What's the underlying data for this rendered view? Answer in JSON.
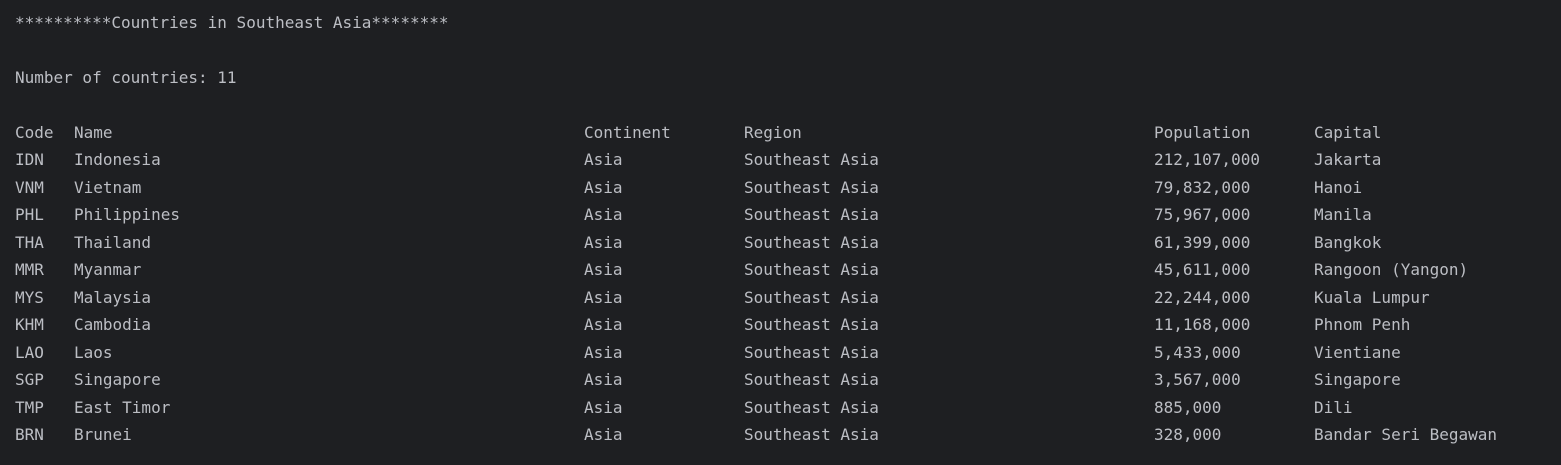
{
  "banner": "**********Countries in Southeast Asia********",
  "count_line": "Number of countries: 11",
  "table": {
    "headers": [
      "Code",
      "Name",
      "Continent",
      "Region",
      "Population",
      "Capital"
    ],
    "rows": [
      [
        "IDN",
        "Indonesia",
        "Asia",
        "Southeast Asia",
        "212,107,000",
        "Jakarta"
      ],
      [
        "VNM",
        "Vietnam",
        "Asia",
        "Southeast Asia",
        "79,832,000",
        "Hanoi"
      ],
      [
        "PHL",
        "Philippines",
        "Asia",
        "Southeast Asia",
        "75,967,000",
        "Manila"
      ],
      [
        "THA",
        "Thailand",
        "Asia",
        "Southeast Asia",
        "61,399,000",
        "Bangkok"
      ],
      [
        "MMR",
        "Myanmar",
        "Asia",
        "Southeast Asia",
        "45,611,000",
        "Rangoon (Yangon)"
      ],
      [
        "MYS",
        "Malaysia",
        "Asia",
        "Southeast Asia",
        "22,244,000",
        "Kuala Lumpur"
      ],
      [
        "KHM",
        "Cambodia",
        "Asia",
        "Southeast Asia",
        "11,168,000",
        "Phnom Penh"
      ],
      [
        "LAO",
        "Laos",
        "Asia",
        "Southeast Asia",
        "5,433,000",
        "Vientiane"
      ],
      [
        "SGP",
        "Singapore",
        "Asia",
        "Southeast Asia",
        "3,567,000",
        "Singapore"
      ],
      [
        "TMP",
        "East Timor",
        "Asia",
        "Southeast Asia",
        "885,000",
        "Dili"
      ],
      [
        "BRN",
        "Brunei",
        "Asia",
        "Southeast Asia",
        "328,000",
        "Bandar Seri Begawan"
      ]
    ]
  },
  "colors": {
    "background": "#1e1f22",
    "text": "#bcbec4"
  }
}
